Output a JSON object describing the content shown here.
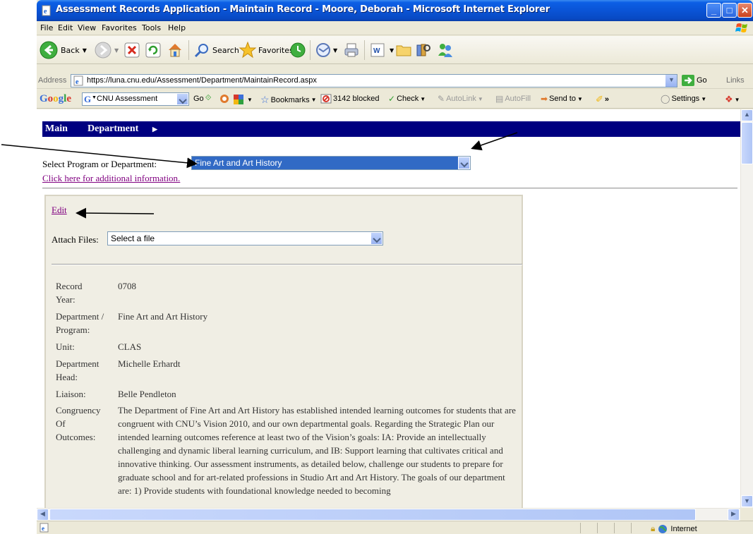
{
  "window": {
    "title": "Assessment Records Application - Maintain Record - Moore, Deborah - Microsoft Internet Explorer",
    "minimize": "_",
    "maximize": "□",
    "close": "✕"
  },
  "menu": [
    "File",
    "Edit",
    "View",
    "Favorites",
    "Tools",
    "Help"
  ],
  "toolbar": {
    "back_label": "Back",
    "search_label": "Search",
    "favorites_label": "Favorites"
  },
  "address": {
    "label": "Address",
    "url": "https://luna.cnu.edu/Assessment/Department/MaintainRecord.aspx",
    "go_label": "Go",
    "links_label": "Links"
  },
  "google_toolbar": {
    "logo": "Google",
    "search_value": "CNU Assessment",
    "go_label": "Go",
    "bookmarks_label": "Bookmarks",
    "blocked_label": "3142 blocked",
    "check_label": "Check",
    "autolink_label": "AutoLink",
    "autofill_label": "AutoFill",
    "sendto_label": "Send to",
    "settings_label": "Settings"
  },
  "page": {
    "nav": {
      "main": "Main",
      "department": "Department"
    },
    "select_label": "Select Program or Department:",
    "program_selected": "Fine Art and Art History",
    "more_info_link": "Click here for additional information.",
    "edit_link": "Edit",
    "attach_label": "Attach Files:",
    "attach_placeholder": "Select a file",
    "record": {
      "year_label_1": "Record",
      "year_label_2": "Year:",
      "year_value": "0708",
      "dept_label_1": "Department /",
      "dept_label_2": "Program:",
      "dept_value": "Fine Art and Art History",
      "unit_label": "Unit:",
      "unit_value": "CLAS",
      "head_label_1": "Department",
      "head_label_2": "Head:",
      "head_value": "Michelle Erhardt",
      "liaison_label": "Liaison:",
      "liaison_value": "Belle Pendleton",
      "congruency_label_1": "Congruency",
      "congruency_label_2": "Of",
      "congruency_label_3": "Outcomes:",
      "congruency_value": "The Department of Fine Art and Art History has established intended learning outcomes for students that are congruent with CNU’s Vision 2010, and our own departmental goals. Regarding the Strategic Plan our intended learning outcomes reference at least two of the Vision’s goals: IA: Provide an intellectually challenging and dynamic liberal learning curriculum, and IB: Support learning that cultivates critical and innovative thinking. Our assessment instruments, as detailed below, challenge our students to prepare for graduate school and for art-related professions in Studio Art and Art History. The goals of our department are: 1) Provide students with foundational knowledge needed to becoming"
    }
  },
  "status": {
    "zone": "Internet"
  },
  "colors": {
    "nav_bg": "#000080",
    "title_bar": "#0a54d6",
    "selected": "#316ac5",
    "visited_link": "#800080"
  }
}
